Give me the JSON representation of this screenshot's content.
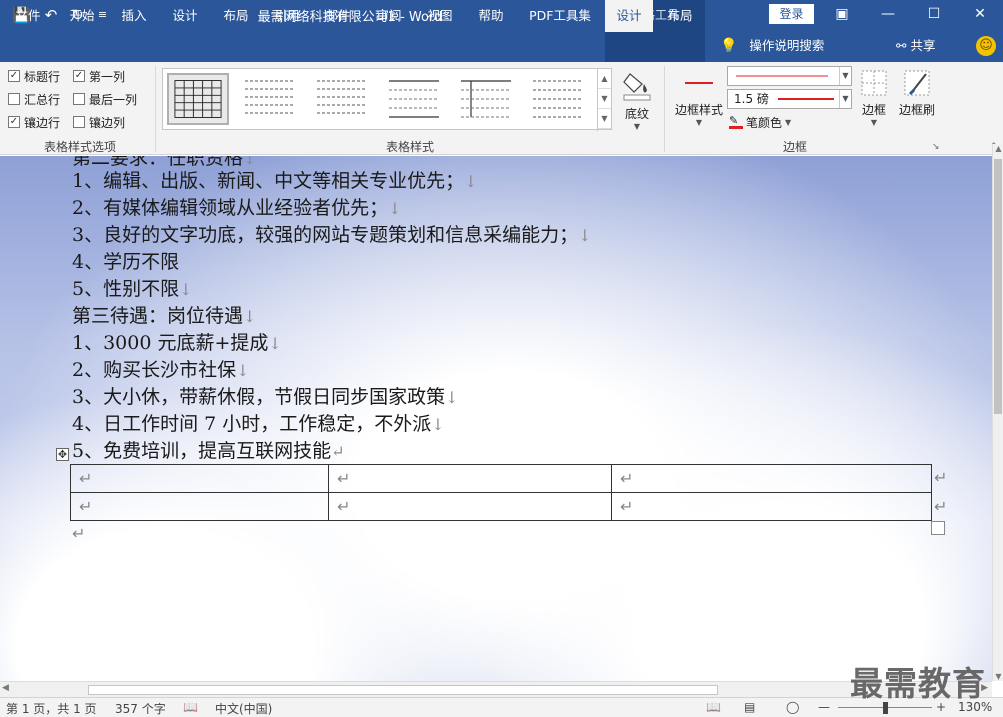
{
  "titlebar": {
    "doc_title": "最需网络科技有限公司1  -  Word",
    "context_group": "表格工具",
    "login": "登录",
    "qat": [
      "save-icon",
      "undo-icon",
      "redo-icon",
      "customize-icon"
    ],
    "window_controls": [
      "ribbon-display-icon",
      "minimize-icon",
      "maximize-icon",
      "close-icon"
    ]
  },
  "tabs": [
    "文件",
    "开始",
    "插入",
    "设计",
    "布局",
    "引用",
    "邮件",
    "审阅",
    "视图",
    "帮助",
    "PDF工具集",
    "设计",
    "布局"
  ],
  "active_tab_index": 11,
  "tellme": "操作说明搜索",
  "share": "共享",
  "ribbon": {
    "options": {
      "label": "表格样式选项",
      "items": [
        {
          "label": "标题行",
          "checked": true
        },
        {
          "label": "第一列",
          "checked": true
        },
        {
          "label": "汇总行",
          "checked": false
        },
        {
          "label": "最后一列",
          "checked": false
        },
        {
          "label": "镶边行",
          "checked": true
        },
        {
          "label": "镶边列",
          "checked": false
        }
      ]
    },
    "styles": {
      "label": "表格样式",
      "shading": "底纹"
    },
    "borders": {
      "label": "边框",
      "border_styles": "边框样式",
      "weight": "1.5 磅",
      "pen_color": "笔颜色",
      "borders_btn": "边框",
      "border_painter": "边框刷",
      "pen_color_value": "#e02020"
    }
  },
  "document": {
    "lines": [
      {
        "text": "第二要求：任职资格",
        "mark": "↓"
      },
      {
        "text": "1、编辑、出版、新闻、中文等相关专业优先；",
        "mark": "↓"
      },
      {
        "text": "2、有媒体编辑领域从业经验者优先；",
        "mark": "↓"
      },
      {
        "text": "3、良好的文字功底，较强的网站专题策划和信息采编能力；",
        "mark": "↓"
      },
      {
        "text": "4、学历不限",
        "mark": ""
      },
      {
        "text": "5、性别不限",
        "mark": "↓"
      },
      {
        "text": "第三待遇：岗位待遇",
        "mark": "↓"
      },
      {
        "text": "1、3000 元底薪+提成",
        "mark": "↓"
      },
      {
        "text": "2、购买长沙市社保",
        "mark": "↓"
      },
      {
        "text": "3、大小休，带薪休假，节假日同步国家政策",
        "mark": "↓"
      },
      {
        "text": "4、日工作时间 7 小时，工作稳定，不外派",
        "mark": "↓"
      },
      {
        "text": "5、免费培训，提高互联网技能",
        "mark": "↵"
      }
    ],
    "table": {
      "rows": [
        [
          "↵",
          "↵",
          "↵"
        ],
        [
          "↵",
          "↵",
          "↵"
        ]
      ],
      "row_end_marks": [
        "↵",
        "↵"
      ]
    },
    "after_table_mark": "↵"
  },
  "statusbar": {
    "page": "第 1 页，共 1 页",
    "words": "357 个字",
    "language": "中文(中国)",
    "zoom": "130%"
  },
  "watermark": "最需教育"
}
